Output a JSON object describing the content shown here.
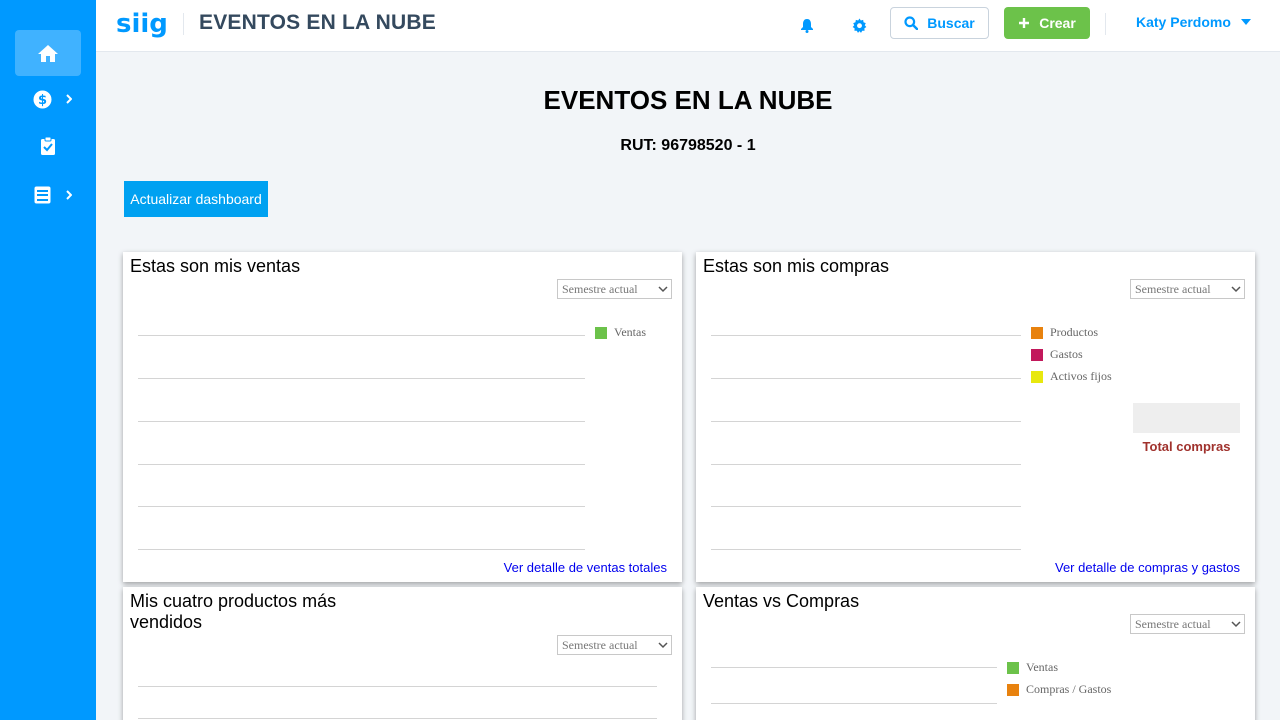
{
  "app": {
    "brand": "siigo",
    "title": "EVENTOS EN LA NUBE"
  },
  "header": {
    "search_label": "Buscar",
    "create_label": "Crear",
    "user_name": "Katy Perdomo",
    "icons": [
      "bell-icon",
      "gear-icon",
      "search-icon",
      "plus-icon",
      "caret-down-icon"
    ]
  },
  "sidebar": {
    "items": [
      {
        "icon": "home-icon",
        "active": true,
        "has_submenu": false
      },
      {
        "icon": "dollar-icon",
        "active": false,
        "has_submenu": true
      },
      {
        "icon": "clipboard-check-icon",
        "active": false,
        "has_submenu": false
      },
      {
        "icon": "book-icon",
        "active": false,
        "has_submenu": true
      }
    ]
  },
  "company": {
    "name": "EVENTOS EN LA NUBE",
    "rut": "RUT: 96798520 - 1"
  },
  "update_button": "Actualizar dashboard",
  "period_option": "Semestre actual",
  "cards": {
    "ventas": {
      "title": "Estas son mis ventas",
      "legend": [
        {
          "label": "Ventas",
          "color": "#6cc24a"
        }
      ],
      "link": "Ver detalle de ventas totales"
    },
    "compras": {
      "title": "Estas son mis compras",
      "legend": [
        {
          "label": "Productos",
          "color": "#e8820e"
        },
        {
          "label": "Gastos",
          "color": "#c2185b"
        },
        {
          "label": "Activos fijos",
          "color": "#e8e80e"
        }
      ],
      "total_label": "Total compras",
      "link": "Ver detalle de compras y gastos"
    },
    "productos": {
      "title": "Mis cuatro productos más vendidos"
    },
    "ventas_vs_compras": {
      "title": "Ventas vs Compras",
      "legend": [
        {
          "label": "Ventas",
          "color": "#6cc24a"
        },
        {
          "label": "Compras / Gastos",
          "color": "#e8820e"
        }
      ]
    }
  },
  "colors": {
    "primary": "#0099ff",
    "accent_green": "#6cc24a",
    "total_red": "#a0322d"
  }
}
